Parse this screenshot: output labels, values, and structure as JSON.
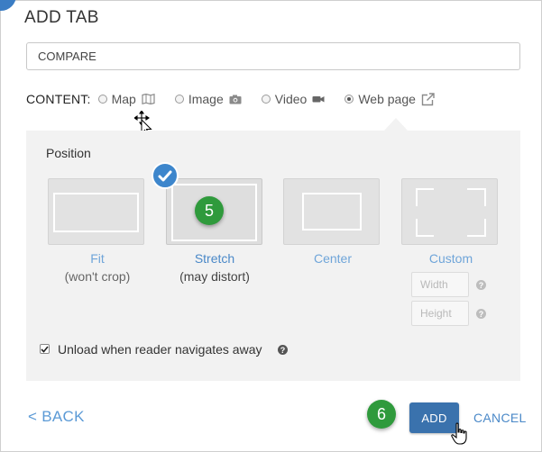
{
  "dialog": {
    "title": "ADD TAB",
    "tab_name_value": "COMPARE"
  },
  "content": {
    "label": "CONTENT:",
    "options": [
      {
        "label": "Map",
        "icon": "map-book-icon",
        "selected": false
      },
      {
        "label": "Image",
        "icon": "camera-icon",
        "selected": false
      },
      {
        "label": "Video",
        "icon": "video-camera-icon",
        "selected": false
      },
      {
        "label": "Web page",
        "icon": "external-link-icon",
        "selected": true
      }
    ]
  },
  "position": {
    "label": "Position",
    "options": [
      {
        "name": "Fit",
        "sub": "(won't crop)",
        "selected": false
      },
      {
        "name": "Stretch",
        "sub": "(may distort)",
        "selected": true
      },
      {
        "name": "Center",
        "sub": "",
        "selected": false
      },
      {
        "name": "Custom",
        "sub": "",
        "selected": false
      }
    ],
    "width_placeholder": "Width",
    "height_placeholder": "Height"
  },
  "unload": {
    "label": "Unload when reader navigates away",
    "checked": true
  },
  "steps": {
    "step_a": "5",
    "step_b": "6"
  },
  "footer": {
    "back_label": "< BACK",
    "add_label": "ADD",
    "cancel_label": "CANCEL"
  },
  "colors": {
    "accent": "#3a72ad",
    "link": "#4b89c8",
    "step_badge": "#2f9a3c",
    "panel_bg": "#f2f2f2"
  }
}
